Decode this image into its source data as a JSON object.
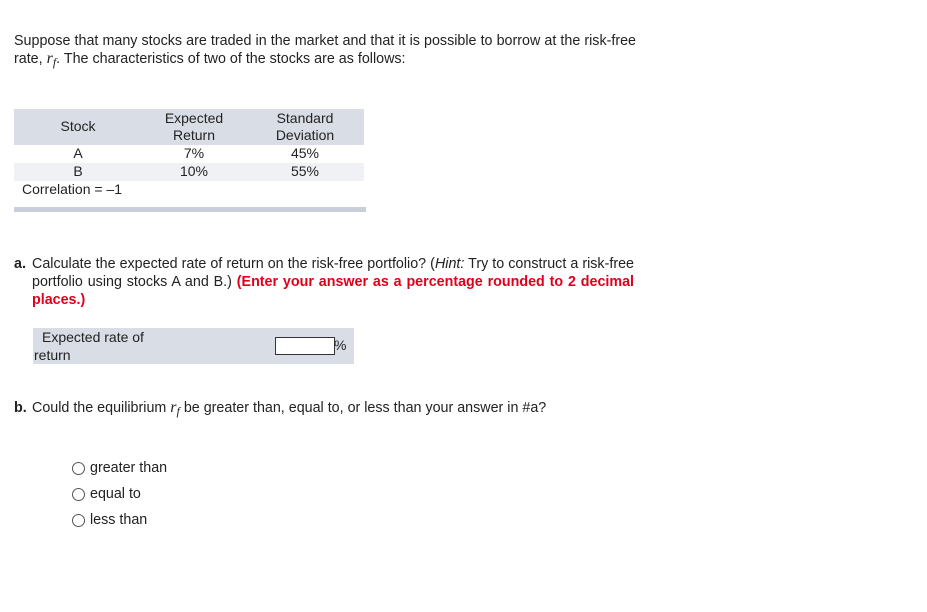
{
  "intro": {
    "text_before": "Suppose that many stocks are traded in the market and that it is possible to borrow at the risk-free rate, ",
    "rf_symbol": "r",
    "rf_sub": "f",
    "text_after": ". The characteristics of two of the stocks are as follows:"
  },
  "stock_table": {
    "headers": {
      "stock": "Stock",
      "return_l1": "Expected",
      "return_l2": "Return",
      "sd_l1": "Standard",
      "sd_l2": "Deviation"
    },
    "rows": [
      {
        "stock": "A",
        "expected_return": "7%",
        "std_dev": "45%"
      },
      {
        "stock": "B",
        "expected_return": "10%",
        "std_dev": "55%"
      }
    ],
    "footnote": "Correlation = –1"
  },
  "part_a": {
    "letter": "a.",
    "question_text": "Calculate the expected rate of return on the risk-free portfolio? (",
    "hint_label": "Hint:",
    "hint_text": " Try to construct a risk-free portfolio using stocks A and B.) ",
    "instruction": "(Enter your answer as a percentage rounded to 2 decimal places.)",
    "answer_label_l1": "Expected rate of",
    "answer_label_l2": "return",
    "answer_value": "",
    "answer_unit": "%"
  },
  "part_b": {
    "letter": "b.",
    "text_before": "Could the equilibrium ",
    "rf_symbol": "r",
    "rf_sub": "f",
    "text_after": " be greater than, equal to, or less than your answer in #a?",
    "options": [
      "greater than",
      "equal to",
      "less than"
    ]
  }
}
